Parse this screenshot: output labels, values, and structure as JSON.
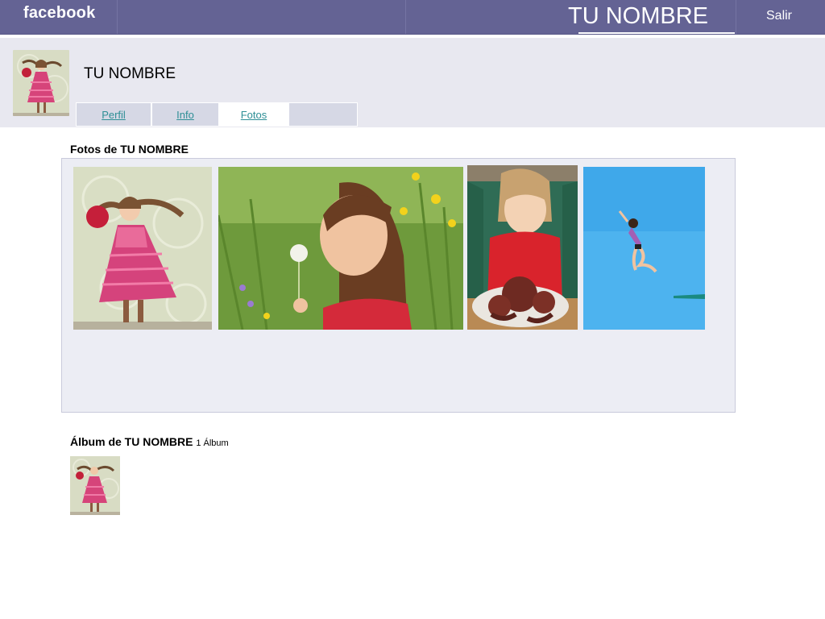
{
  "topbar": {
    "brand": "facebook",
    "title": "TU NOMBRE",
    "logout_label": "Salir",
    "color": "#646394"
  },
  "profile": {
    "name": "TU NOMBRE",
    "avatar": "girl-pink-dress-photo",
    "tabs": [
      {
        "label": "Perfil",
        "active": false
      },
      {
        "label": "Info",
        "active": false
      },
      {
        "label": "Fotos",
        "active": true
      },
      {
        "label": "",
        "active": false
      }
    ]
  },
  "photos": {
    "heading": "Fotos de TU NOMBRE",
    "items": [
      {
        "name": "girl-pink-dress-photo"
      },
      {
        "name": "girl-dandelion-photo"
      },
      {
        "name": "girl-octopus-photo"
      },
      {
        "name": "girl-jumping-sky-photo"
      }
    ]
  },
  "albums": {
    "heading": "Álbum de TU NOMBRE",
    "count_label": "1 Álbum",
    "items": [
      {
        "name": "girl-pink-dress-photo"
      }
    ]
  },
  "colors": {
    "link": "#2e8f96",
    "band": "#e8e8f0",
    "panel": "#ecedf4",
    "tab": "#d6d8e5"
  }
}
